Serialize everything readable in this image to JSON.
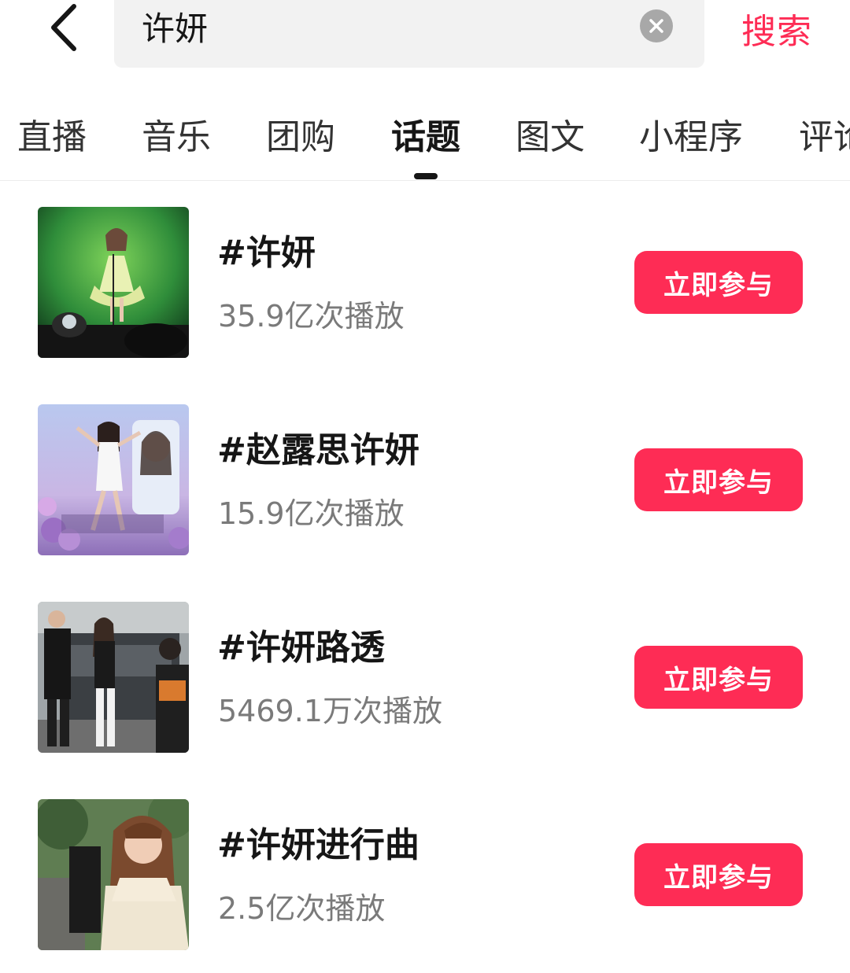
{
  "header": {
    "back_icon": "chevron-left-icon",
    "search_value": "许妍",
    "clear_icon": "close-circle-icon",
    "search_action_label": "搜索"
  },
  "tabs": [
    {
      "label": "直播",
      "active": false
    },
    {
      "label": "音乐",
      "active": false
    },
    {
      "label": "团购",
      "active": false
    },
    {
      "label": "话题",
      "active": true
    },
    {
      "label": "图文",
      "active": false
    },
    {
      "label": "小程序",
      "active": false
    },
    {
      "label": "评论",
      "active": false
    }
  ],
  "topics": [
    {
      "title": "#许妍",
      "plays": "35.9亿次播放",
      "button": "立即参与"
    },
    {
      "title": "#赵露思许妍",
      "plays": "15.9亿次播放",
      "button": "立即参与"
    },
    {
      "title": "#许妍路透",
      "plays": "5469.1万次播放",
      "button": "立即参与"
    },
    {
      "title": "#许妍进行曲",
      "plays": "2.5亿次播放",
      "button": "立即参与"
    }
  ],
  "colors": {
    "accent": "#fe2c55",
    "text_primary": "#161616",
    "text_secondary": "#7a7a7a",
    "search_bg": "#f2f2f2"
  }
}
